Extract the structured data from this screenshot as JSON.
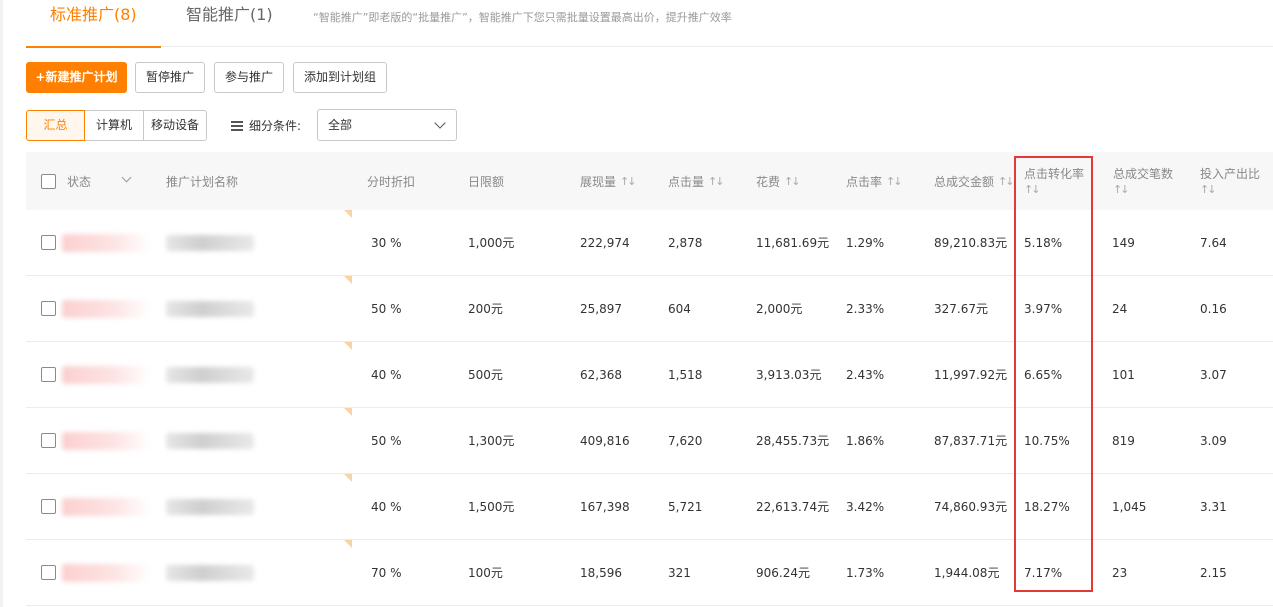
{
  "tabs": {
    "standard": "标准推广(8)",
    "smart": "智能推广(1)",
    "hint": "“智能推广”即老版的“批量推广”，智能推广下您只需批量设置最高出价，提升推广效率"
  },
  "toolbar": {
    "new_plan": "+新建推广计划",
    "pause": "暂停推广",
    "join": "参与推广",
    "add_group": "添加到计划组"
  },
  "device_filter": {
    "all": "汇总",
    "pc": "计算机",
    "mobile": "移动设备"
  },
  "condition": {
    "label": "细分条件:",
    "value": "全部"
  },
  "table": {
    "headers": {
      "status": "状态",
      "name": "推广计划名称",
      "discount": "分时折扣",
      "budget": "日限额",
      "impressions": "展现量",
      "clicks": "点击量",
      "cost": "花费",
      "ctr": "点击率",
      "gmv": "总成交金额",
      "cvr": "点击转化率",
      "orders": "总成交笔数",
      "roi": "投入产出比"
    },
    "sort_icon": "↑↓",
    "rows": [
      {
        "discount": "30 %",
        "budget": "1,000元",
        "impressions": "222,974",
        "clicks": "2,878",
        "cost": "11,681.69元",
        "ctr": "1.29%",
        "gmv": "89,210.83元",
        "cvr": "5.18%",
        "orders": "149",
        "roi": "7.64"
      },
      {
        "discount": "50 %",
        "budget": "200元",
        "impressions": "25,897",
        "clicks": "604",
        "cost": "2,000元",
        "ctr": "2.33%",
        "gmv": "327.67元",
        "cvr": "3.97%",
        "orders": "24",
        "roi": "0.16"
      },
      {
        "discount": "40 %",
        "budget": "500元",
        "impressions": "62,368",
        "clicks": "1,518",
        "cost": "3,913.03元",
        "ctr": "2.43%",
        "gmv": "11,997.92元",
        "cvr": "6.65%",
        "orders": "101",
        "roi": "3.07"
      },
      {
        "discount": "50 %",
        "budget": "1,300元",
        "impressions": "409,816",
        "clicks": "7,620",
        "cost": "28,455.73元",
        "ctr": "1.86%",
        "gmv": "87,837.71元",
        "cvr": "10.75%",
        "orders": "819",
        "roi": "3.09"
      },
      {
        "discount": "40 %",
        "budget": "1,500元",
        "impressions": "167,398",
        "clicks": "5,721",
        "cost": "22,613.74元",
        "ctr": "3.42%",
        "gmv": "74,860.93元",
        "cvr": "18.27%",
        "orders": "1,045",
        "roi": "3.31"
      },
      {
        "discount": "70 %",
        "budget": "100元",
        "impressions": "18,596",
        "clicks": "321",
        "cost": "906.24元",
        "ctr": "1.73%",
        "gmv": "1,944.08元",
        "cvr": "7.17%",
        "orders": "23",
        "roi": "2.15"
      }
    ]
  },
  "colors": {
    "accent": "#ff8000",
    "highlight_border": "#e53935"
  }
}
